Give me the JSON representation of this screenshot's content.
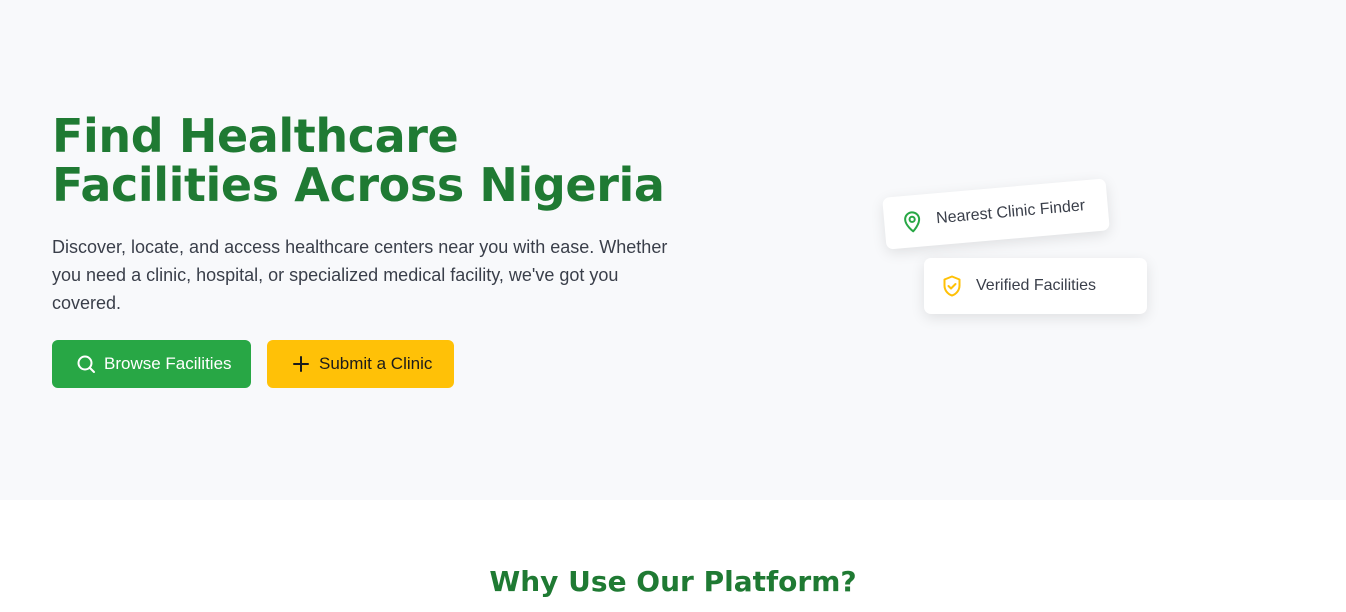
{
  "hero": {
    "title": "Find Healthcare Facilities Across Nigeria",
    "subtitle": "Discover, locate, and access healthcare centers near you with ease. Whether you need a clinic, hospital, or specialized medical facility, we've got you covered.",
    "browse_label": "Browse Facilities",
    "browse_icon": "search-icon",
    "submit_label": "Submit a Clinic",
    "submit_icon": "plus-icon"
  },
  "badges": {
    "finder_label": "Nearest Clinic Finder",
    "finder_icon": "map-pin-icon",
    "verified_label": "Verified Facilities",
    "verified_icon": "shield-check-icon"
  },
  "features": {
    "title": "Why Use Our Platform?"
  },
  "colors": {
    "brand_green": "#1f7a33",
    "button_green": "#28a745",
    "button_yellow": "#ffc107",
    "hero_bg": "#f8f9fb"
  }
}
